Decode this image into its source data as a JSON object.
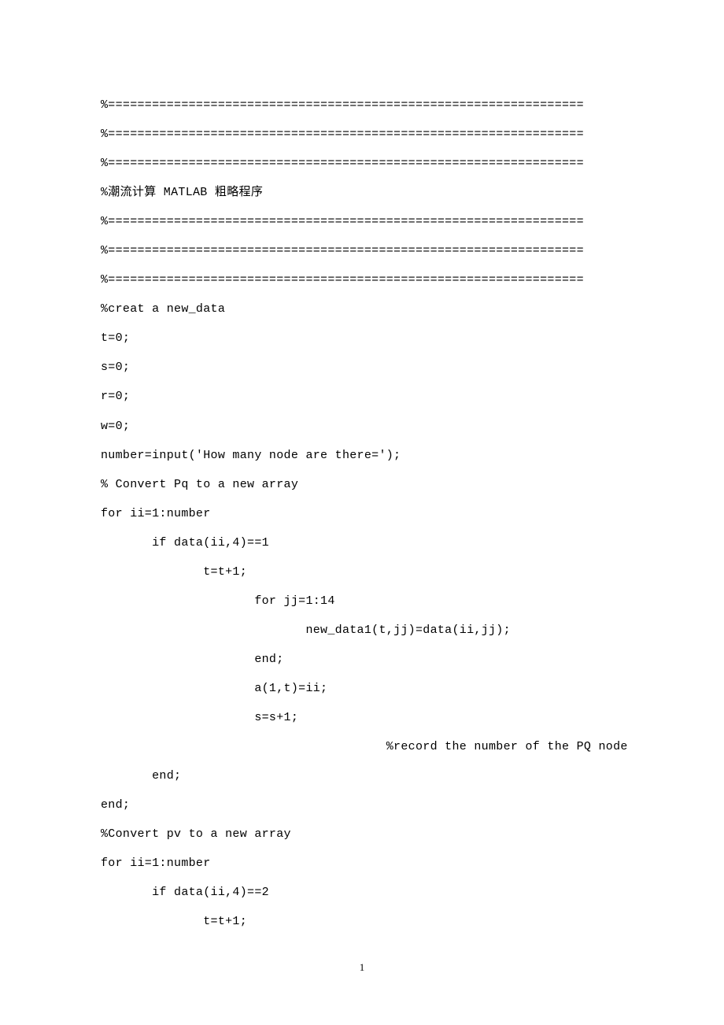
{
  "code": {
    "lines": [
      "%=================================================================",
      "%=================================================================",
      "%=================================================================",
      "%潮流计算 MATLAB 粗略程序",
      "%=================================================================",
      "%=================================================================",
      "%=================================================================",
      "%creat a new_data",
      "t=0;",
      "s=0;",
      "r=0;",
      "w=0;",
      "number=input('How many node are there=');",
      "% Convert Pq to a new array",
      "for ii=1:number",
      "       if data(ii,4)==1",
      "              t=t+1;",
      "                     for jj=1:14",
      "                            new_data1(t,jj)=data(ii,jj);",
      "                     end;",
      "                     a(1,t)=ii;",
      "                     s=s+1;",
      "                                       %record the number of the PQ node",
      "       end;",
      "end;",
      "%Convert pv to a new array",
      "for ii=1:number",
      "       if data(ii,4)==2",
      "              t=t+1;"
    ]
  },
  "page": {
    "number": "1"
  }
}
